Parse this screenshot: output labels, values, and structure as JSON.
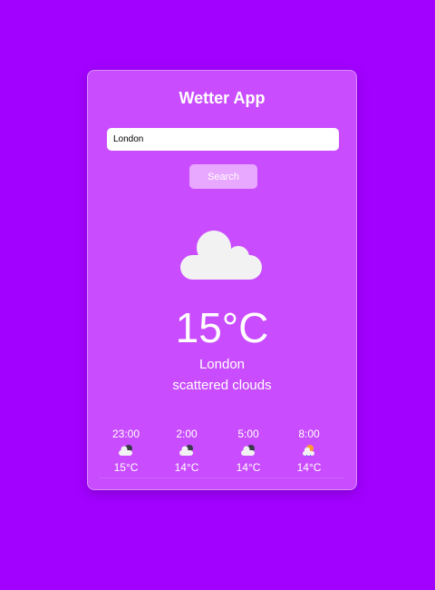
{
  "app": {
    "title": "Wetter App"
  },
  "search": {
    "value": "London",
    "button_label": "Search"
  },
  "current": {
    "icon": "cloud-icon",
    "temperature": "15°C",
    "city": "London",
    "description": "scattered clouds"
  },
  "forecast": [
    {
      "time": "23:00",
      "icon": "cloud-night-icon",
      "temp": "15°C"
    },
    {
      "time": "2:00",
      "icon": "cloud-night-icon",
      "temp": "14°C"
    },
    {
      "time": "5:00",
      "icon": "cloud-night-icon",
      "temp": "14°C"
    },
    {
      "time": "8:00",
      "icon": "cloud-sun-icon",
      "temp": "14°C"
    }
  ],
  "colors": {
    "background": "#a200ff",
    "card": "#c94dff",
    "button": "#e9a8ff",
    "text": "#ffffff",
    "cloud": "#f2f2f2"
  }
}
